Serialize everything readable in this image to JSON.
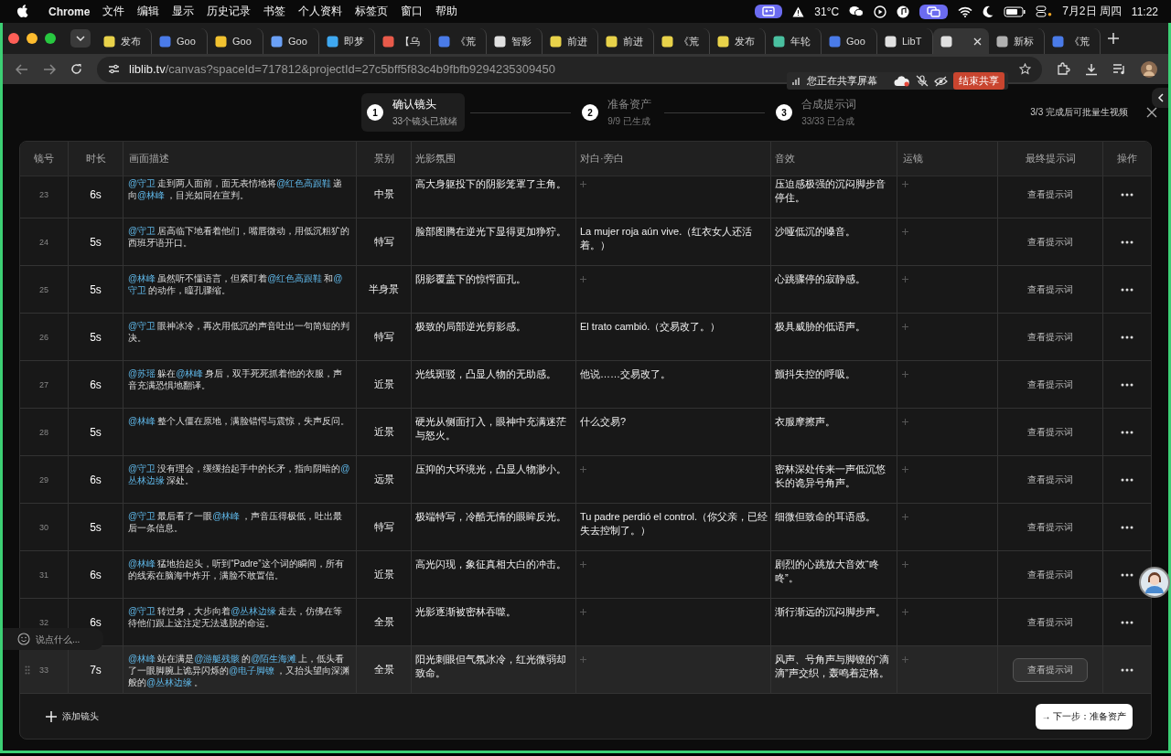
{
  "menu_bar": {
    "app": "Chrome",
    "items": [
      "文件",
      "编辑",
      "显示",
      "历史记录",
      "书签",
      "个人资料",
      "标签页",
      "窗口",
      "帮助"
    ],
    "weather": "31°C",
    "date": "7月2日 周四",
    "time": "11:22"
  },
  "tabs": [
    {
      "title": "发布",
      "color": "#e8d24a",
      "selected": false
    },
    {
      "title": "Goo",
      "color": "#4a7be8",
      "selected": false
    },
    {
      "title": "Goo",
      "color": "#f2c230",
      "selected": false
    },
    {
      "title": "Goo",
      "color": "#6aa0f5",
      "selected": false
    },
    {
      "title": "即梦",
      "color": "#3fa8f0",
      "selected": false
    },
    {
      "title": "【乌",
      "color": "#e85a4a",
      "selected": false
    },
    {
      "title": "《荒",
      "color": "#4a7be8",
      "selected": false
    },
    {
      "title": "智影",
      "color": "#e0e0e0",
      "selected": false
    },
    {
      "title": "前进",
      "color": "#e8d24a",
      "selected": false
    },
    {
      "title": "前进",
      "color": "#e8d24a",
      "selected": false
    },
    {
      "title": "《荒",
      "color": "#e8d24a",
      "selected": false
    },
    {
      "title": "发布",
      "color": "#e8d24a",
      "selected": false
    },
    {
      "title": "年轮",
      "color": "#4ac0a0",
      "selected": false
    },
    {
      "title": "Goo",
      "color": "#4a7be8",
      "selected": false
    },
    {
      "title": "LibT",
      "color": "#e0e0e0",
      "selected": false
    },
    {
      "color": "#e0e0e0",
      "selected": true
    },
    {
      "title": "新标",
      "color": "#b0b0b0",
      "selected": false
    },
    {
      "title": "《荒",
      "color": "#4a7be8",
      "selected": false
    }
  ],
  "address_bar": {
    "url_host": "liblib.tv",
    "url_path": "/canvas?spaceId=717812&projectId=27c5bff5f83c4b9fbfb9294235309450"
  },
  "sharing_bar": {
    "message": "您正在共享屏幕",
    "stop_button": "结束共享"
  },
  "stepper": {
    "steps": [
      {
        "number": "1",
        "title": "确认镜头",
        "subtitle": "33个镜头已就绪",
        "selected": true
      },
      {
        "number": "2",
        "title": "准备资产",
        "subtitle": "9/9 已生成",
        "selected": false
      },
      {
        "number": "3",
        "title": "合成提示词",
        "subtitle": "33/33 已合成",
        "selected": false
      }
    ],
    "hint": "3/3 完成后可批量生视频"
  },
  "table": {
    "columns": [
      "镜号",
      "时长",
      "画面描述",
      "景别",
      "光影氛围",
      "对白·旁白",
      "音效",
      "运镜",
      "最终提示词",
      "操作"
    ],
    "rows": [
      {
        "number": "23",
        "duration": "6s",
        "description": [
          {
            "kind": "mention",
            "text": "@守卫"
          },
          {
            "kind": "text",
            "text": "走到两人面前，面无表情地将"
          },
          {
            "kind": "mention",
            "text": "@红色高跟鞋"
          },
          {
            "kind": "text",
            "text": "递向"
          },
          {
            "kind": "mention",
            "text": "@林峰"
          },
          {
            "kind": "text",
            "text": "，目光如同在宣判。"
          }
        ],
        "shot": "中景",
        "lighting": "高大身躯投下的阴影笼罩了主角。",
        "sound": "压迫感极强的沉闷脚步音停住。",
        "prompt_button": "查看提示词",
        "hovered": false
      },
      {
        "number": "24",
        "duration": "5s",
        "description": [
          {
            "kind": "mention",
            "text": "@守卫"
          },
          {
            "kind": "text",
            "text": "居高临下地看着他们，嘴唇微动，用低沉粗犷的西班牙语开口。"
          }
        ],
        "shot": "特写",
        "lighting": "脸部图腾在逆光下显得更加狰狞。",
        "dialogue": "La mujer roja aún vive.（红衣女人还活着。）",
        "sound": "沙哑低沉的嗓音。",
        "prompt_button": "查看提示词",
        "hovered": false
      },
      {
        "number": "25",
        "duration": "5s",
        "description": [
          {
            "kind": "mention",
            "text": "@林峰"
          },
          {
            "kind": "text",
            "text": "虽然听不懂语言，但紧盯着"
          },
          {
            "kind": "mention",
            "text": "@红色高跟鞋"
          },
          {
            "kind": "text",
            "text": "和"
          },
          {
            "kind": "mention",
            "text": "@守卫"
          },
          {
            "kind": "text",
            "text": "的动作，瞳孔骤缩。"
          }
        ],
        "shot": "半身景",
        "lighting": "阴影覆盖下的惊愕面孔。",
        "sound": "心跳骤停的寂静感。",
        "prompt_button": "查看提示词",
        "hovered": false
      },
      {
        "number": "26",
        "duration": "5s",
        "description": [
          {
            "kind": "mention",
            "text": "@守卫"
          },
          {
            "kind": "text",
            "text": "眼神冰冷，再次用低沉的声音吐出一句简短的判决。"
          }
        ],
        "shot": "特写",
        "lighting": "极致的局部逆光剪影感。",
        "dialogue": "El trato cambió.（交易改了。）",
        "sound": "极具威胁的低语声。",
        "prompt_button": "查看提示词",
        "hovered": false
      },
      {
        "number": "27",
        "duration": "6s",
        "description": [
          {
            "kind": "mention",
            "text": "@苏瑶"
          },
          {
            "kind": "text",
            "text": "躲在"
          },
          {
            "kind": "mention",
            "text": "@林峰"
          },
          {
            "kind": "text",
            "text": "身后，双手死死抓着他的衣服，声音充满恐惧地翻译。"
          }
        ],
        "shot": "近景",
        "lighting": "光线斑驳，凸显人物的无助感。",
        "dialogue": "他说……交易改了。",
        "sound": "颤抖失控的呼吸。",
        "prompt_button": "查看提示词",
        "hovered": false
      },
      {
        "number": "28",
        "duration": "5s",
        "description": [
          {
            "kind": "mention",
            "text": "@林峰"
          },
          {
            "kind": "text",
            "text": "整个人僵在原地，满脸错愕与震惊，失声反问。"
          }
        ],
        "shot": "近景",
        "lighting": "硬光从侧面打入，眼神中充满迷茫与怒火。",
        "dialogue": "什么交易?",
        "sound": "衣服摩擦声。",
        "prompt_button": "查看提示词",
        "hovered": false
      },
      {
        "number": "29",
        "duration": "6s",
        "description": [
          {
            "kind": "mention",
            "text": "@守卫"
          },
          {
            "kind": "text",
            "text": "没有理会，缓缓抬起手中的长矛，指向阴暗的"
          },
          {
            "kind": "mention",
            "text": "@丛林边缘"
          },
          {
            "kind": "text",
            "text": "深处。"
          }
        ],
        "shot": "远景",
        "lighting": "压抑的大环境光，凸显人物渺小。",
        "sound": "密林深处传来一声低沉悠长的诡异号角声。",
        "prompt_button": "查看提示词",
        "hovered": false
      },
      {
        "number": "30",
        "duration": "5s",
        "description": [
          {
            "kind": "mention",
            "text": "@守卫"
          },
          {
            "kind": "text",
            "text": "最后看了一眼"
          },
          {
            "kind": "mention",
            "text": "@林峰"
          },
          {
            "kind": "text",
            "text": "，声音压得极低，吐出最后一条信息。"
          }
        ],
        "shot": "特写",
        "lighting": "极端特写，冷酷无情的眼眸反光。",
        "dialogue": "Tu padre perdió el control.（你父亲，已经失去控制了。）",
        "sound": "细微但致命的耳语感。",
        "prompt_button": "查看提示词",
        "hovered": false
      },
      {
        "number": "31",
        "duration": "6s",
        "description": [
          {
            "kind": "mention",
            "text": "@林峰"
          },
          {
            "kind": "text",
            "text": "猛地抬起头，听到“Padre”这个词的瞬间，所有的线索在脑海中炸开，满脸不敢置信。"
          }
        ],
        "shot": "近景",
        "lighting": "高光闪现，象征真相大白的冲击。",
        "sound": "剧烈的心跳放大音效“咚咚”。",
        "prompt_button": "查看提示词",
        "hovered": false
      },
      {
        "number": "32",
        "duration": "6s",
        "description": [
          {
            "kind": "mention",
            "text": "@守卫"
          },
          {
            "kind": "text",
            "text": "转过身，大步向着"
          },
          {
            "kind": "mention",
            "text": "@丛林边缘"
          },
          {
            "kind": "text",
            "text": "走去，仿佛在等待他们跟上这注定无法逃脱的命运。"
          }
        ],
        "shot": "全景",
        "lighting": "光影逐渐被密林吞噬。",
        "sound": "渐行渐远的沉闷脚步声。",
        "prompt_button": "查看提示词",
        "hovered": false
      },
      {
        "number": "33",
        "duration": "7s",
        "description": [
          {
            "kind": "mention",
            "text": "@林峰"
          },
          {
            "kind": "text",
            "text": "站在满是"
          },
          {
            "kind": "mention",
            "text": "@游艇残骸"
          },
          {
            "kind": "text",
            "text": "的"
          },
          {
            "kind": "mention",
            "text": "@陌生海滩"
          },
          {
            "kind": "text",
            "text": "上，低头看了一眼脚腕上诡异闪烁的"
          },
          {
            "kind": "mention",
            "text": "@电子脚镣"
          },
          {
            "kind": "text",
            "text": "，又抬头望向深渊般的"
          },
          {
            "kind": "mention",
            "text": "@丛林边缘"
          },
          {
            "kind": "text",
            "text": "。"
          }
        ],
        "shot": "全景",
        "lighting": "阳光刺眼但气氛冰冷，红光微弱却致命。",
        "sound": "风声、号角声与脚镣的“滴滴”声交织，轰鸣着定格。",
        "prompt_button": "查看提示词",
        "hovered": true
      }
    ],
    "add_button": "添加镜头",
    "next_button": "→ 下一步：准备资产"
  },
  "chat_input": {
    "placeholder": "说点什么..."
  }
}
